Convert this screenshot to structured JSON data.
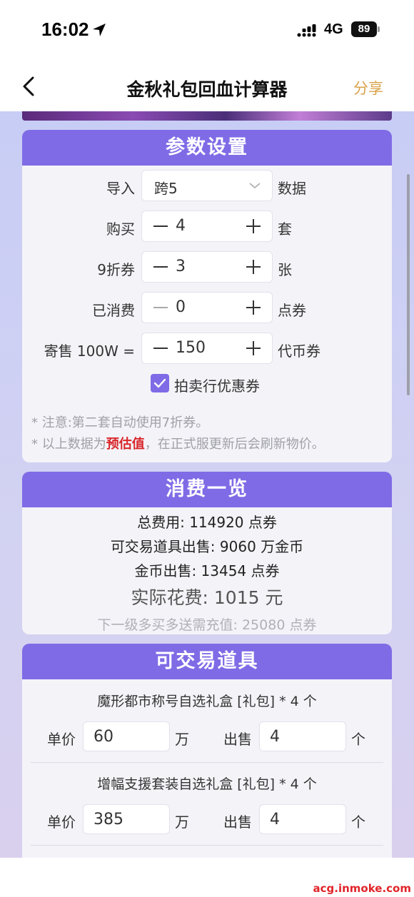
{
  "status": {
    "time": "16:02",
    "network": "4G",
    "battery": "89"
  },
  "nav": {
    "title": "金秋礼包回血计算器",
    "share": "分享"
  },
  "params": {
    "title": "参数设置",
    "import_label": "导入",
    "import_value": "跨5",
    "import_unit": "数据",
    "buy_label": "购买",
    "buy_value": "4",
    "buy_unit": "套",
    "coupon_label": "9折券",
    "coupon_value": "3",
    "coupon_unit": "张",
    "spent_label": "已消费",
    "spent_value": "0",
    "spent_unit": "点券",
    "sell_label": "寄售 100W =",
    "sell_value": "150",
    "sell_unit": "代币券",
    "auction_label": "拍卖行优惠券",
    "auction_checked": true,
    "note1": "* 注意:第二套自动使用7折券。",
    "note2_prefix": "* 以上数据为",
    "note2_highlight": "预估值",
    "note2_suffix": "，在正式服更新后会刷新物价。"
  },
  "summary": {
    "title": "消费一览",
    "total": "总费用: 114920 点券",
    "tradable_sale": "可交易道具出售: 9060 万金币",
    "gold_sale": "金币出售: 13454 点券",
    "actual": "实际花费: 1015 元",
    "next_level": "下一级多买多送需充值: 25080 点券"
  },
  "tradable": {
    "title": "可交易道具",
    "unit_price_label": "单价",
    "wan_label": "万",
    "sell_label": "出售",
    "ge_label": "个",
    "items": [
      {
        "name": "魔形都市称号自选礼盒 [礼包] * 4 个",
        "price": "60",
        "sell": "4"
      },
      {
        "name": "增幅支援套装自选礼盒 [礼包] * 4 个",
        "price": "385",
        "sell": "4"
      }
    ]
  },
  "watermark": "acg.inmoke.com",
  "colors": {
    "accent": "#7f6be6",
    "highlight": "#d8262a",
    "share": "#d9a24a"
  }
}
